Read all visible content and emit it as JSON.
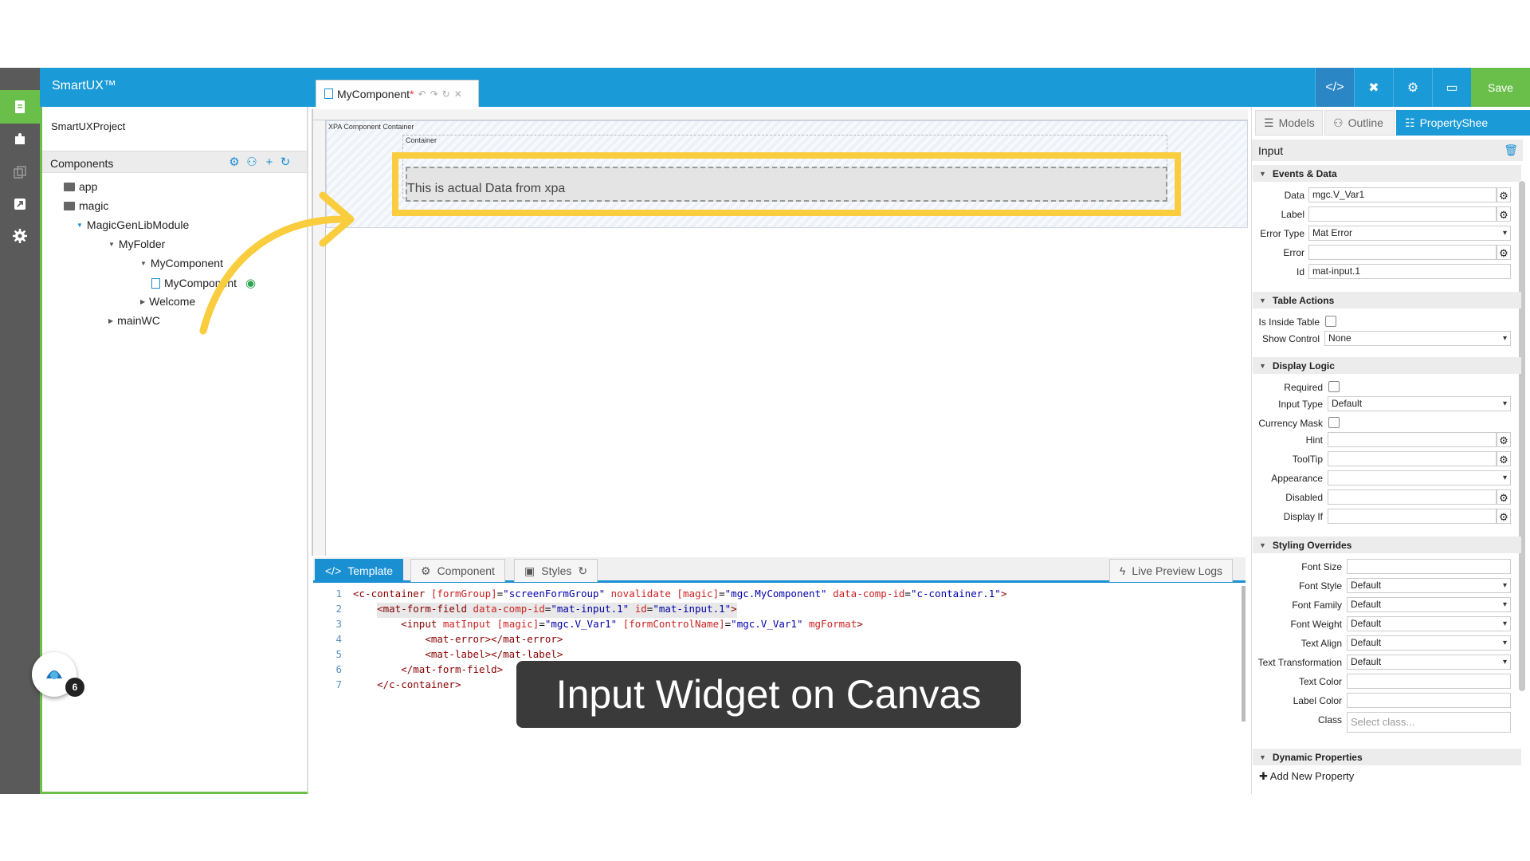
{
  "app": {
    "title": "SmartUX™",
    "save_label": "Save"
  },
  "sidebar": {
    "project": "SmartUXProject",
    "components_header": "Components",
    "tree": [
      {
        "label": "app",
        "type": "folder"
      },
      {
        "label": "magic",
        "type": "folder"
      },
      {
        "label": "MagicGenLibModule",
        "type": "expanded"
      },
      {
        "label": "MyFolder",
        "type": "expanded"
      },
      {
        "label": "MyComponent",
        "type": "expanded"
      },
      {
        "label": "MyComponent",
        "type": "file"
      },
      {
        "label": "Welcome",
        "type": "collapsed"
      },
      {
        "label": "mainWC",
        "type": "collapsed"
      }
    ]
  },
  "editor": {
    "tab_label": "MyComponent",
    "tab_modified": "*",
    "canvas": {
      "xpa_label": "XPA Component Container",
      "container_label": "Container",
      "input_text": "This is actual Data from xpa"
    },
    "bottom_tabs": {
      "template": "Template",
      "component": "Component",
      "styles": "Styles",
      "live_preview": "Live Preview Logs"
    },
    "code_lines": [
      {
        "n": "1",
        "indent": "",
        "parts": [
          [
            "t",
            "<c-container "
          ],
          [
            "a",
            "[formGroup]"
          ],
          [
            "p",
            "="
          ],
          [
            "s",
            "\"screenFormGroup\""
          ],
          [
            "a",
            " novalidate "
          ],
          [
            "a",
            "[magic]"
          ],
          [
            "p",
            "="
          ],
          [
            "s",
            "\"mgc.MyComponent\""
          ],
          [
            "a",
            " data-comp-id"
          ],
          [
            "p",
            "="
          ],
          [
            "s",
            "\"c-container.1\""
          ],
          [
            "t",
            ">"
          ]
        ]
      },
      {
        "n": "2",
        "indent": "    ",
        "parts": [
          [
            "t",
            "<mat-form-field "
          ],
          [
            "a",
            "data-comp-id"
          ],
          [
            "p",
            "="
          ],
          [
            "s",
            "\"mat-input.1\""
          ],
          [
            "a",
            " id"
          ],
          [
            "p",
            "="
          ],
          [
            "s",
            "\"mat-input.1\""
          ],
          [
            "t",
            ">"
          ]
        ]
      },
      {
        "n": "3",
        "indent": "        ",
        "parts": [
          [
            "t",
            "<input "
          ],
          [
            "a",
            "matInput "
          ],
          [
            "a",
            "[magic]"
          ],
          [
            "p",
            "="
          ],
          [
            "s",
            "\"mgc.V_Var1\""
          ],
          [
            "a",
            " [formControlName]"
          ],
          [
            "p",
            "="
          ],
          [
            "s",
            "\"mgc.V_Var1\""
          ],
          [
            "a",
            " mgFormat"
          ],
          [
            "t",
            ">"
          ]
        ]
      },
      {
        "n": "4",
        "indent": "            ",
        "parts": [
          [
            "t",
            "<mat-error></mat-error>"
          ]
        ]
      },
      {
        "n": "5",
        "indent": "            ",
        "parts": [
          [
            "t",
            "<mat-label></mat-label>"
          ]
        ]
      },
      {
        "n": "6",
        "indent": "        ",
        "parts": [
          [
            "t",
            "</mat-form-field>"
          ]
        ]
      },
      {
        "n": "7",
        "indent": "    ",
        "parts": [
          [
            "t",
            "</c-container>"
          ]
        ]
      }
    ]
  },
  "right_panel": {
    "tabs": {
      "models": "Models",
      "outline": "Outline",
      "property_sheet": "PropertyShee"
    },
    "selected": "Input",
    "sections": {
      "events": "Events & Data",
      "table": "Table Actions",
      "display": "Display Logic",
      "styling": "Styling Overrides",
      "dynamic": "Dynamic Properties"
    },
    "events": {
      "data_label": "Data",
      "data_value": "mgc.V_Var1",
      "label_label": "Label",
      "label_value": "",
      "error_type_label": "Error Type",
      "error_type_value": "Mat Error",
      "error_label": "Error",
      "error_value": "",
      "id_label": "Id",
      "id_value": "mat-input.1"
    },
    "table": {
      "inside_label": "Is Inside Table",
      "show_control_label": "Show Control",
      "show_control_value": "None"
    },
    "display": {
      "required_label": "Required",
      "input_type_label": "Input Type",
      "input_type_value": "Default",
      "currency_label": "Currency Mask",
      "hint_label": "Hint",
      "tooltip_label": "ToolTip",
      "appearance_label": "Appearance",
      "disabled_label": "Disabled",
      "displayif_label": "Display If"
    },
    "styling": {
      "font_size_label": "Font Size",
      "font_style_label": "Font Style",
      "font_style_value": "Default",
      "font_family_label": "Font Family",
      "font_family_value": "Default",
      "font_weight_label": "Font Weight",
      "font_weight_value": "Default",
      "text_align_label": "Text Align",
      "text_align_value": "Default",
      "text_transform_label": "Text Transformation",
      "text_transform_value": "Default",
      "text_color_label": "Text Color",
      "label_color_label": "Label Color",
      "class_label": "Class",
      "class_placeholder": "Select class..."
    },
    "add_property": "Add New Property"
  },
  "caption": "Input Widget on Canvas",
  "fab_badge": "6",
  "colors": {
    "brand_blue": "#1a9ad6",
    "save_green": "#6abf4b",
    "highlight": "#f9cd3e"
  }
}
